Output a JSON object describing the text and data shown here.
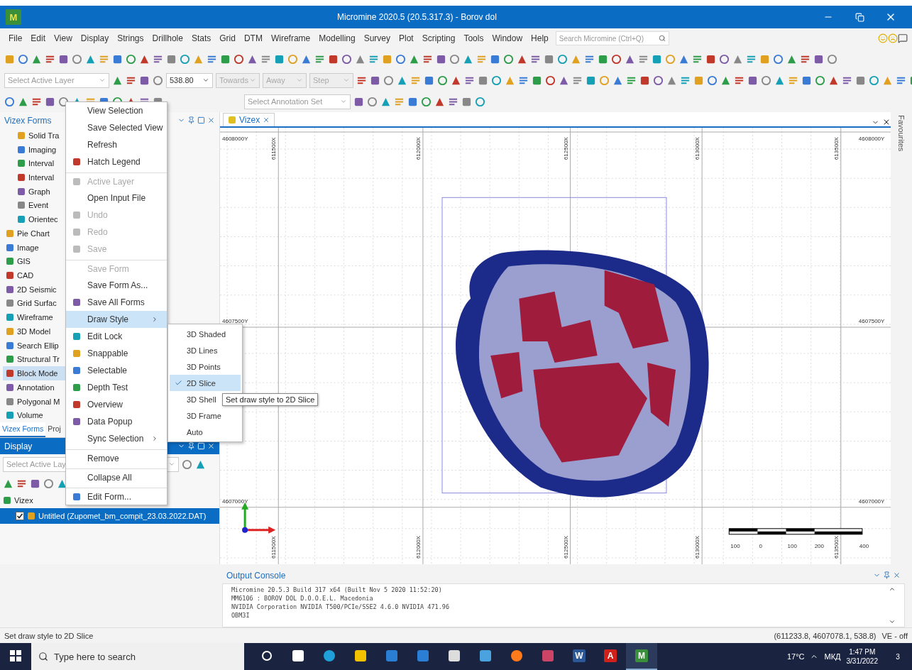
{
  "window": {
    "logo": "M",
    "title": "Micromine 2020.5 (20.5.317.3) - Borov dol"
  },
  "menu_bar": {
    "items": [
      "File",
      "Edit",
      "View",
      "Display",
      "Strings",
      "Drillhole",
      "Stats",
      "Grid",
      "DTM",
      "Wireframe",
      "Modelling",
      "Survey",
      "Plot",
      "Scripting",
      "Tools",
      "Window",
      "Help"
    ],
    "search": {
      "placeholder": "Search Micromine (Ctrl+Q)"
    }
  },
  "toolbar_2": {
    "layer_select": {
      "placeholder": "Select Active Layer"
    },
    "elevation": "538.80",
    "towards": {
      "label": "Towards",
      "disabled": true
    },
    "away": {
      "label": "Away",
      "disabled": true
    },
    "step": {
      "label": "Step",
      "disabled": true
    }
  },
  "toolbar_3": {
    "annotation_select": {
      "placeholder": "Select Annotation Set"
    }
  },
  "vizex_forms_panel": {
    "title": "Vizex Forms",
    "tree": [
      {
        "children": [
          {
            "label": "Solid Tra",
            "selected": false
          },
          {
            "label": "Imaging",
            "selected": false
          },
          {
            "label": "Interval",
            "selected": false
          },
          {
            "label": "Interval",
            "selected": false
          },
          {
            "label": "Graph",
            "selected": false
          },
          {
            "label": "Event",
            "selected": false
          },
          {
            "label": "Orientec",
            "selected": false
          }
        ]
      },
      {
        "label": "Pie Chart",
        "selected": false
      },
      {
        "label": "Image",
        "selected": false
      },
      {
        "label": "GIS",
        "selected": false
      },
      {
        "label": "CAD",
        "selected": false
      },
      {
        "label": "2D Seismic",
        "selected": false
      },
      {
        "label": "Grid Surfac",
        "selected": false
      },
      {
        "label": "Wireframe",
        "selected": false
      },
      {
        "label": "3D Model",
        "selected": false
      },
      {
        "label": "Search Ellip",
        "selected": false
      },
      {
        "label": "Structural Tr",
        "selected": false
      },
      {
        "label": "Block Mode",
        "selected": true
      },
      {
        "label": "Annotation",
        "selected": false
      },
      {
        "label": "Polygonal M",
        "selected": false
      },
      {
        "label": "Volume",
        "selected": false
      }
    ]
  },
  "panel_tabs": [
    {
      "label": "Vizex Forms",
      "selected": true
    },
    {
      "label": "Proj",
      "selected": false
    }
  ],
  "display_panel": {
    "title": "Display",
    "layer_select": {
      "placeholder": "Select Active Lay"
    },
    "tree": [
      {
        "label": "Vizex",
        "children": [
          {
            "label": "Untitled (Zupomet_bm_compit_23.03.2022.DAT)",
            "checked": true,
            "selected": true
          }
        ]
      }
    ]
  },
  "document_tabs": [
    {
      "label": "Vizex",
      "selected": true
    }
  ],
  "side_tab": "Favourites",
  "canvas": {
    "y_labels_left": [
      "4608000Y",
      "4607500Y",
      "4607000Y"
    ],
    "y_labels_right": [
      "4608000Y",
      "4607500Y",
      "4607000Y"
    ],
    "x_labels_top": [
      "611500X",
      "612000X",
      "612500X",
      "613000X",
      "613500X"
    ],
    "x_labels_bottom": [
      "611500X",
      "612000X",
      "612500X",
      "613000X",
      "613500X"
    ],
    "scale_labels": [
      "100",
      "0",
      "100",
      "200",
      "400"
    ]
  },
  "context_menu": {
    "items": [
      {
        "label": "View Selection",
        "kind": "plain",
        "disabled": false,
        "selected": false,
        "separator_before": false
      },
      {
        "label": "Save Selected View",
        "kind": "plain",
        "disabled": false,
        "selected": false,
        "separator_before": false
      },
      {
        "label": "Refresh",
        "kind": "plain",
        "disabled": false,
        "selected": false,
        "separator_before": false
      },
      {
        "label": "Hatch Legend",
        "kind": "icon",
        "disabled": false,
        "selected": false,
        "separator_before": false
      },
      {
        "label": "Active Layer",
        "kind": "icon",
        "disabled": true,
        "selected": false,
        "separator_before": true
      },
      {
        "label": "Open Input File",
        "kind": "plain",
        "disabled": false,
        "selected": false,
        "separator_before": false
      },
      {
        "label": "Undo",
        "kind": "icon",
        "disabled": true,
        "selected": false,
        "separator_before": false
      },
      {
        "label": "Redo",
        "kind": "icon",
        "disabled": true,
        "selected": false,
        "separator_before": false
      },
      {
        "label": "Save",
        "kind": "icon",
        "disabled": true,
        "selected": false,
        "separator_before": false
      },
      {
        "label": "Save Form",
        "kind": "plain",
        "disabled": true,
        "selected": false,
        "separator_before": true
      },
      {
        "label": "Save Form As...",
        "kind": "plain",
        "disabled": false,
        "selected": false,
        "separator_before": false
      },
      {
        "label": "Save All Forms",
        "kind": "icon",
        "disabled": false,
        "selected": false,
        "separator_before": false
      },
      {
        "label": "Draw Style",
        "kind": "submenu",
        "disabled": false,
        "selected": true,
        "separator_before": false
      },
      {
        "label": "Edit Lock",
        "kind": "icon",
        "disabled": false,
        "selected": false,
        "separator_before": false
      },
      {
        "label": "Snappable",
        "kind": "icon",
        "disabled": false,
        "selected": false,
        "separator_before": false
      },
      {
        "label": "Selectable",
        "kind": "icon",
        "disabled": false,
        "selected": false,
        "separator_before": false
      },
      {
        "label": "Depth Test",
        "kind": "icon",
        "disabled": false,
        "selected": false,
        "separator_before": false
      },
      {
        "label": "Overview",
        "kind": "icon",
        "disabled": false,
        "selected": false,
        "separator_before": false
      },
      {
        "label": "Data Popup",
        "kind": "icon",
        "disabled": false,
        "selected": false,
        "separator_before": false
      },
      {
        "label": "Sync Selection",
        "kind": "submenu",
        "disabled": false,
        "selected": false,
        "separator_before": false
      },
      {
        "label": "Remove",
        "kind": "plain",
        "disabled": false,
        "selected": false,
        "separator_before": true
      },
      {
        "label": "Collapse All",
        "kind": "plain",
        "disabled": false,
        "selected": false,
        "separator_before": true
      },
      {
        "label": "Edit Form...",
        "kind": "icon",
        "disabled": false,
        "selected": false,
        "separator_before": true
      }
    ]
  },
  "submenu": {
    "items": [
      {
        "label": "3D Shaded",
        "checked": false,
        "selected": false
      },
      {
        "label": "3D Lines",
        "checked": false,
        "selected": false
      },
      {
        "label": "3D Points",
        "checked": false,
        "selected": false
      },
      {
        "label": "2D Slice",
        "checked": true,
        "selected": true
      },
      {
        "label": "3D Shell",
        "checked": false,
        "selected": false
      },
      {
        "label": "3D Frame",
        "checked": false,
        "selected": false
      },
      {
        "label": "Auto",
        "checked": false,
        "selected": false
      }
    ]
  },
  "tooltip": "Set draw style to 2D Slice",
  "output_console": {
    "title": "Output Console",
    "lines": [
      "Micromine 20.5.3 Build 317 x64 (Built Nov  5 2020 11:52:20)",
      "MM6106 : BOROV DOL D.O.O.E.L. Macedonia",
      "NVIDIA Corporation NVIDIA T500/PCIe/SSE2 4.6.0 NVIDIA 471.96",
      "OBM3I"
    ]
  },
  "status_bar": {
    "message": "Set draw style to 2D Slice",
    "coordinates": "(611233.8, 4607078.1, 538.8)",
    "ve": "VE - off"
  },
  "taskbar": {
    "search": {
      "placeholder": "Type here to search"
    },
    "apps": [
      {
        "kind": "cortana",
        "active": false
      },
      {
        "kind": "taskview",
        "active": false
      },
      {
        "kind": "edge",
        "active": false
      },
      {
        "kind": "files",
        "active": false
      },
      {
        "kind": "store",
        "active": false
      },
      {
        "kind": "mail",
        "active": false
      },
      {
        "kind": "hex",
        "active": false
      },
      {
        "kind": "tool",
        "active": false
      },
      {
        "kind": "firefox",
        "active": false
      },
      {
        "kind": "paint",
        "active": false
      },
      {
        "kind": "word",
        "letter": "W",
        "active": false
      },
      {
        "kind": "acrobat",
        "letter": "A",
        "active": false
      },
      {
        "kind": "micromine",
        "letter": "M",
        "active": true
      }
    ],
    "temperature": "17°C",
    "language": "МКД",
    "time": "1:47 PM",
    "date": "3/31/2022",
    "notifications": "3"
  }
}
